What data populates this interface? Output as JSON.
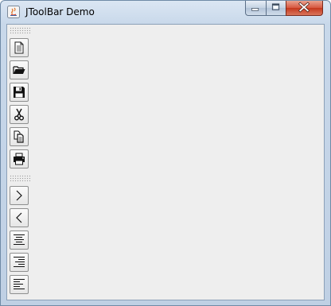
{
  "window": {
    "title": "JToolBar Demo"
  },
  "title_controls": {
    "minimize": "minimize-icon",
    "maximize": "maximize-icon",
    "close": "close-icon"
  },
  "toolbar_file": {
    "buttons": [
      {
        "icon": "new-document-icon"
      },
      {
        "icon": "open-folder-icon"
      },
      {
        "icon": "save-icon"
      },
      {
        "icon": "cut-icon"
      },
      {
        "icon": "copy-icon"
      },
      {
        "icon": "print-icon"
      }
    ]
  },
  "toolbar_format": {
    "buttons": [
      {
        "icon": "chevron-right-icon"
      },
      {
        "icon": "chevron-left-icon"
      },
      {
        "icon": "align-center-icon"
      },
      {
        "icon": "align-right-icon"
      },
      {
        "icon": "align-left-icon"
      }
    ]
  },
  "colors": {
    "client_bg": "#eeeeee",
    "close_button": "#c5381d"
  }
}
